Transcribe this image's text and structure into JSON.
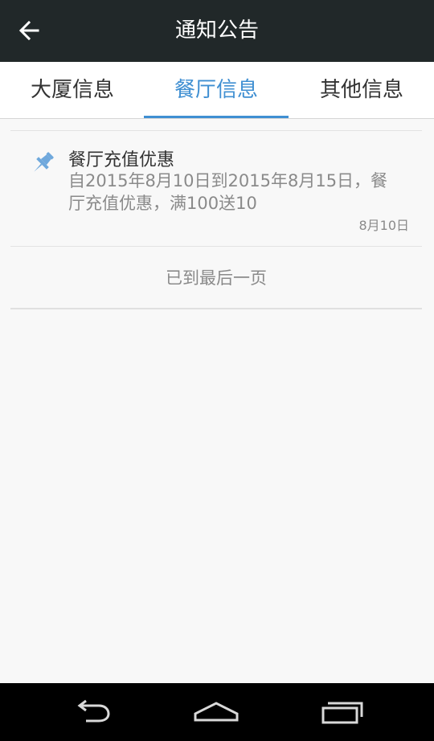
{
  "header": {
    "title": "通知公告",
    "back_icon": "arrow-left-icon"
  },
  "tabs": [
    {
      "label": "大厦信息",
      "active": false
    },
    {
      "label": "餐厅信息",
      "active": true
    },
    {
      "label": "其他信息",
      "active": false
    }
  ],
  "notices": [
    {
      "icon": "pushpin-icon",
      "title": "餐厅充值优惠",
      "body": "自2015年8月10日到2015年8月15日，餐厅充值优惠，满100送10",
      "date": "8月10日"
    }
  ],
  "list_end_label": "已到最后一页",
  "system_nav": {
    "back_icon": "nav-back-icon",
    "home_icon": "nav-home-icon",
    "recents_icon": "nav-recents-icon"
  },
  "colors": {
    "header_bg": "#212829",
    "accent": "#3f8fd2",
    "page_bg": "#f8f8f8",
    "nav_bg": "#000000"
  }
}
